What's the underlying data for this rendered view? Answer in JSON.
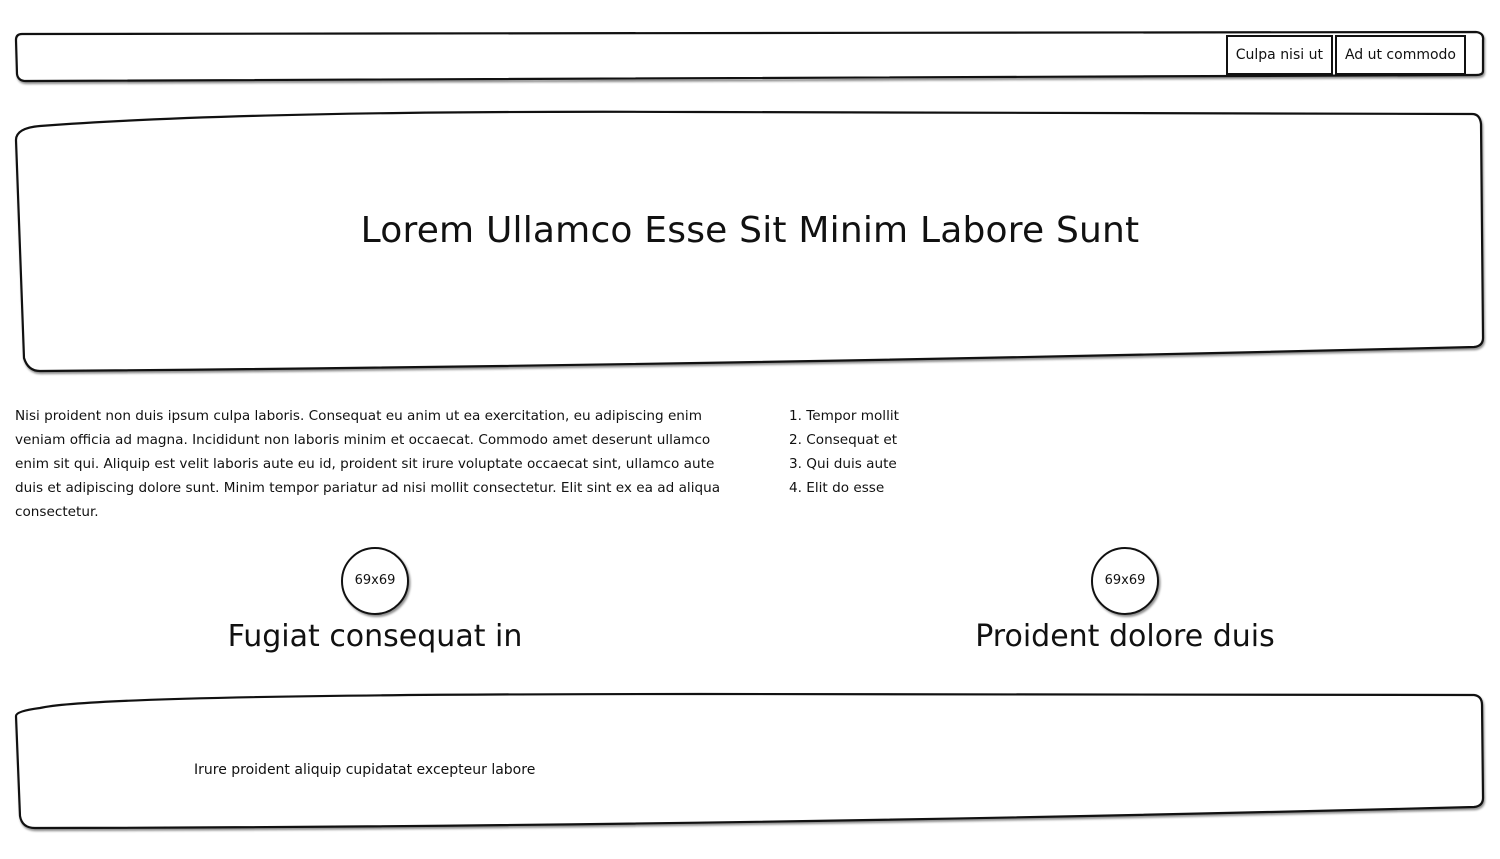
{
  "nav": {
    "buttons": [
      {
        "label": "Culpa nisi ut"
      },
      {
        "label": "Ad ut commodo"
      }
    ]
  },
  "hero": {
    "title": "Lorem Ullamco Esse Sit Minim Labore Sunt"
  },
  "content": {
    "paragraph": "Nisi proident non duis ipsum culpa laboris. Consequat eu anim ut ea exercitation, eu adipiscing enim veniam officia ad magna. Incididunt non laboris minim et occaecat. Commodo amet deserunt ullamco enim sit qui. Aliquip est velit laboris aute eu id, proident sit irure voluptate occaecat sint, ullamco aute duis et adipiscing dolore sunt. Minim tempor pariatur ad nisi mollit consectetur. Elit sint ex ea ad aliqua consectetur.",
    "list": [
      "1. Tempor mollit",
      "2. Consequat et",
      "3. Qui duis aute",
      "4. Elit do esse"
    ]
  },
  "features": [
    {
      "image_label": "69x69",
      "title": "Fugiat consequat in"
    },
    {
      "image_label": "69x69",
      "title": "Proident dolore duis"
    }
  ],
  "footer": {
    "text": "Irure proident aliquip cupidatat excepteur labore"
  }
}
